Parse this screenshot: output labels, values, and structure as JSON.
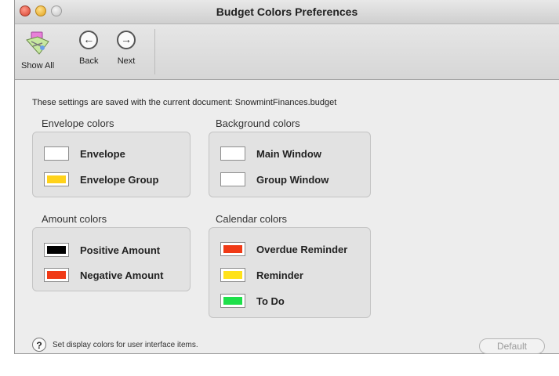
{
  "window": {
    "title": "Budget Colors Preferences"
  },
  "toolbar": {
    "show_all": "Show All",
    "back": "Back",
    "next": "Next"
  },
  "note": "These settings are saved with the current document:  SnowmintFinances.budget",
  "groups": {
    "envelope": {
      "title": "Envelope colors",
      "items": [
        {
          "label": "Envelope",
          "color": "#ffffff"
        },
        {
          "label": "Envelope Group",
          "color": "#ffd21a"
        }
      ]
    },
    "background": {
      "title": "Background colors",
      "items": [
        {
          "label": "Main Window",
          "color": "#ffffff"
        },
        {
          "label": "Group Window",
          "color": "#ffffff"
        }
      ]
    },
    "amount": {
      "title": "Amount colors",
      "items": [
        {
          "label": "Positive Amount",
          "color": "#000000"
        },
        {
          "label": "Negative Amount",
          "color": "#f03a16"
        }
      ]
    },
    "calendar": {
      "title": "Calendar colors",
      "items": [
        {
          "label": "Overdue Reminder",
          "color": "#f03a16"
        },
        {
          "label": "Reminder",
          "color": "#ffe21a"
        },
        {
          "label": "To Do",
          "color": "#1ee04a"
        }
      ]
    }
  },
  "footer": {
    "help_icon": "?",
    "help_text": "Set display colors for user interface items.",
    "default_label": "Default"
  }
}
